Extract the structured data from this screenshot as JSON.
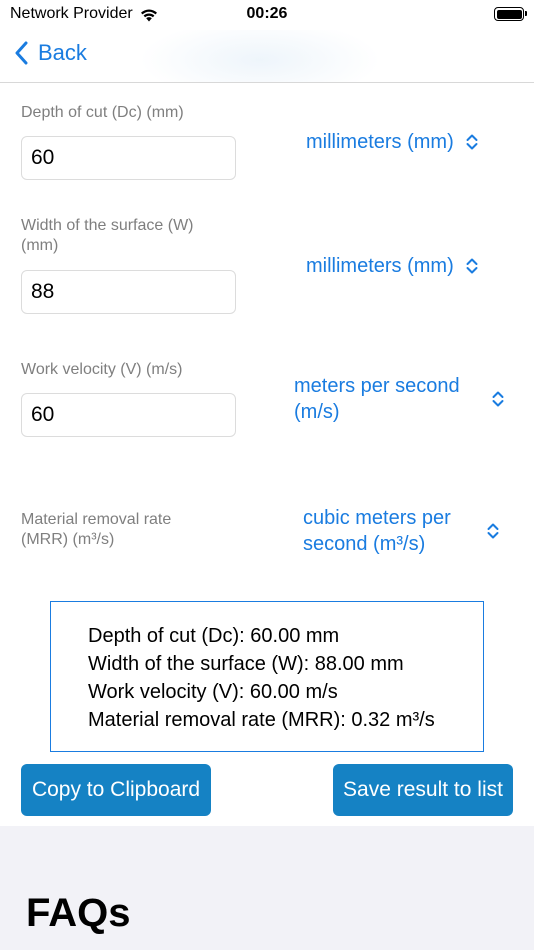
{
  "status_bar": {
    "carrier": "Network Provider",
    "time": "00:26"
  },
  "nav": {
    "back_label": "Back"
  },
  "fields": [
    {
      "label": "Depth of cut (Dc) (mm)",
      "value": "60",
      "unit": "millimeters (mm)"
    },
    {
      "label": "Width of the surface (W) (mm)",
      "value": "88",
      "unit": "millimeters (mm)"
    },
    {
      "label": "Work velocity (V) (m/s)",
      "value": "60",
      "unit": "meters per second (m/s)"
    }
  ],
  "output": {
    "label": "Material removal rate (MRR) (m³/s)",
    "unit": "cubic meters per second (m³/s)"
  },
  "results": [
    "Depth of cut (Dc): 60.00 mm",
    "Width of the surface (W): 88.00 mm",
    "Work velocity (V): 60.00 m/s",
    "Material removal rate (MRR): 0.32 m³/s"
  ],
  "actions": {
    "copy_label": "Copy to Clipboard",
    "save_label": "Save result to list"
  },
  "faq": {
    "title": "FAQs"
  },
  "colors": {
    "accent": "#1a7ce0",
    "button": "#1582c4",
    "label_gray": "#7f7f7f"
  }
}
